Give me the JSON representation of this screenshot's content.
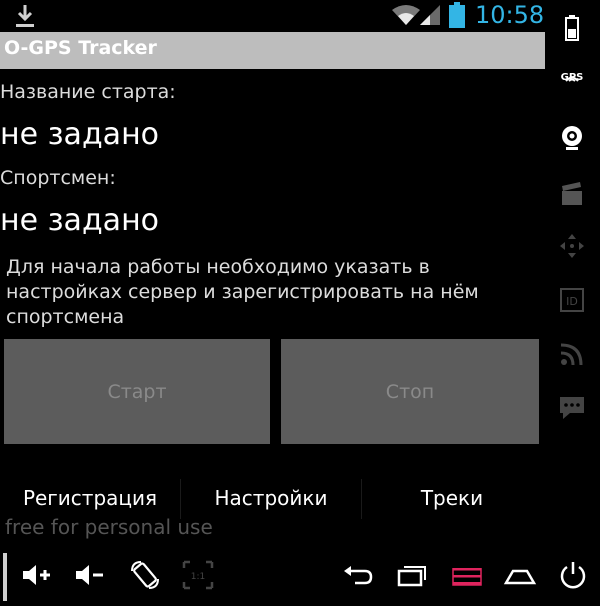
{
  "status_bar": {
    "time": "10:58",
    "time_color": "#33b5e5",
    "icons": [
      "download-icon",
      "wifi-icon",
      "signal-icon",
      "battery-icon"
    ]
  },
  "app": {
    "title": "O-GPS Tracker"
  },
  "side_panel": {
    "gps_label": "GPS",
    "icons": [
      "battery-icon",
      "gps-icon",
      "webcam-icon",
      "clapperboard-icon",
      "move-icon",
      "id-card-icon",
      "rss-icon",
      "chat-icon"
    ]
  },
  "form": {
    "start_name_label": "Название старта:",
    "start_name_value": "не задано",
    "athlete_label": "Спортсмен:",
    "athlete_value": "не задано",
    "info_text": "Для начала работы необходимо указать в настройках сервер и зарегистрировать на нём спортсмена"
  },
  "buttons": {
    "start": "Старт",
    "stop": "Стоп"
  },
  "tabs": [
    {
      "label": "Регистрация"
    },
    {
      "label": "Настройки"
    },
    {
      "label": "Треки"
    }
  ],
  "watermark": "free for personal use",
  "nav_bar": {
    "compat_zoom_label": "1:1",
    "icons": [
      "volume-up-icon",
      "volume-down-icon",
      "rotate-screen-icon",
      "compat-zoom-icon",
      "back-icon",
      "recent-apps-icon",
      "menu-icon",
      "home-icon",
      "power-icon"
    ]
  },
  "colors": {
    "accent_blue": "#33b5e5",
    "action_bar": "#bdbdbd",
    "button_bg": "#5c5c5c",
    "menu_highlight": "#e0245e"
  }
}
